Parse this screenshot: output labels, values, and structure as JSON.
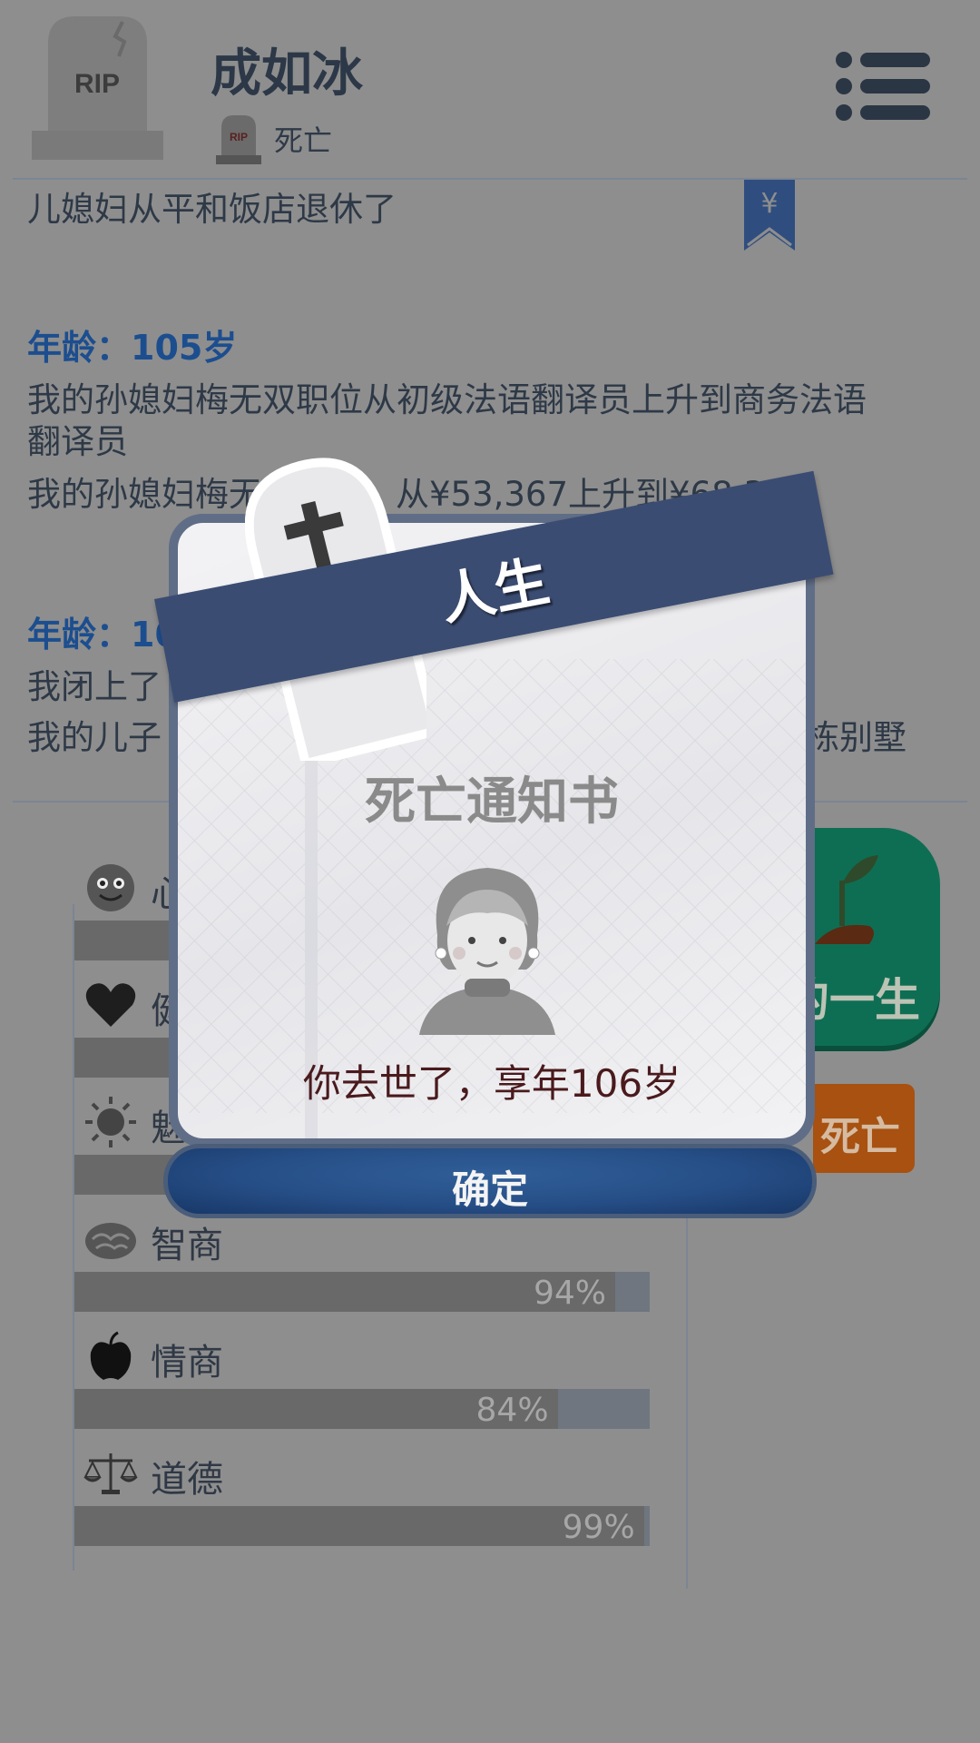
{
  "header": {
    "name": "成如冰",
    "status": "死亡"
  },
  "log": {
    "line_top": "儿媳妇从平和饭店退休了",
    "age_1": "年龄：105岁",
    "line_1a": "我的孙媳妇梅无双职位从初级法语翻译员上升到商务法语",
    "line_1b": "翻译员",
    "line_1c_left": "我的孙媳妇梅无",
    "line_1c_right": "从¥53,367上升到¥68,373",
    "age_2": "年龄：10",
    "line_2a": "我闭上了",
    "line_2b_left": "我的儿子",
    "line_2b_right": "栋别墅"
  },
  "actions": {
    "green_label": "的一生",
    "orange_label": "死亡"
  },
  "stats": [
    {
      "label": "心",
      "icon": "smiley-face-icon",
      "value": null
    },
    {
      "label": "健",
      "icon": "heart-icon",
      "value": null
    },
    {
      "label": "魅",
      "icon": "sun-icon",
      "value": null
    },
    {
      "label": "智商",
      "icon": "brain-icon",
      "value": 94,
      "text": "94%"
    },
    {
      "label": "情商",
      "icon": "apple-icon",
      "value": 84,
      "text": "84%"
    },
    {
      "label": "道德",
      "icon": "scales-icon",
      "value": 99,
      "text": "99%"
    }
  ],
  "modal": {
    "ribbon": "人生",
    "title": "死亡通知书",
    "message": "你去世了，享年106岁",
    "ok": "确定"
  },
  "colors": {
    "overlay_bg": "#8e8e8e",
    "ribbon": "#3b4c72",
    "button": "#264e86",
    "age_blue": "#1c4e8f"
  }
}
